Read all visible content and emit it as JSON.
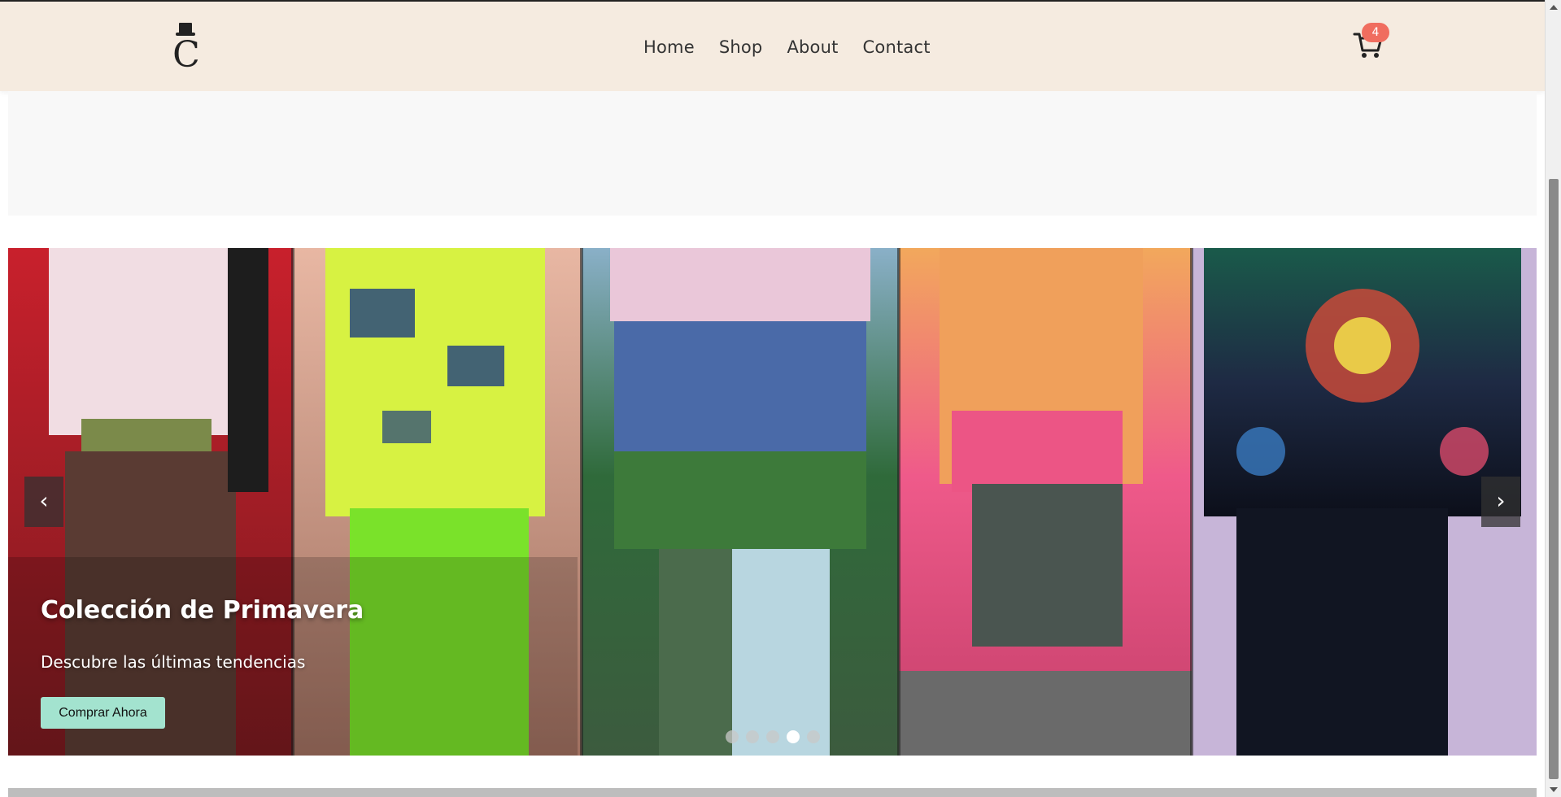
{
  "navbar": {
    "links": [
      "Home",
      "Shop",
      "About",
      "Contact"
    ],
    "cart_count": "4",
    "logo_icon": "top-hat-c-logo",
    "cart_icon": "shopping-cart-icon",
    "background": "#f5ebe0",
    "badge_color": "#f06d5f"
  },
  "carousel": {
    "title": "Colección de Primavera",
    "subtitle": "Descubre las últimas tendencias",
    "cta_label": "Comprar Ahora",
    "cta_color": "#a3e3cf",
    "prev_label": "‹",
    "next_label": "›",
    "slide_count": 5,
    "active_slide": 4
  }
}
